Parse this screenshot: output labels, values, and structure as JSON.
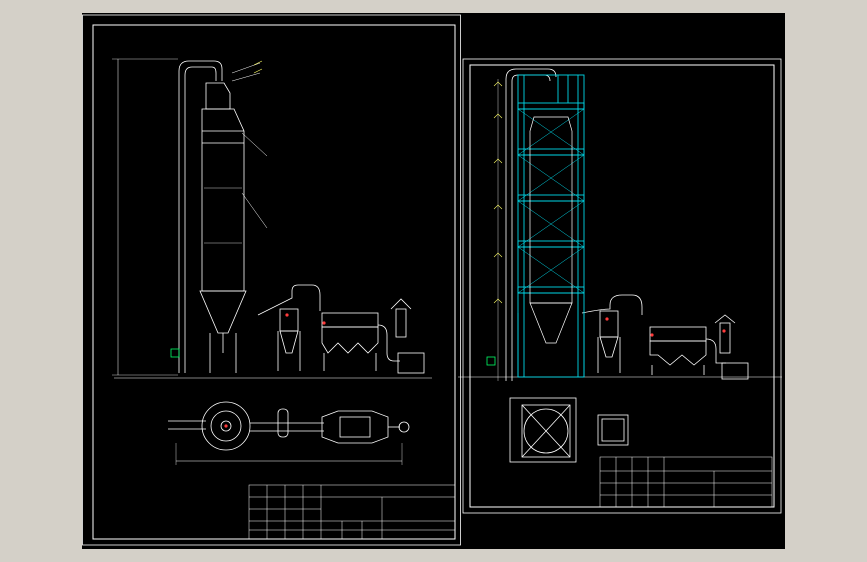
{
  "colors": {
    "background": "#d4d0c8",
    "canvas": "#000000",
    "line": "#ffffff",
    "structure": "#00d8e8",
    "annotation": "#ffff66",
    "accent": "#ff3b3b",
    "ground": "#00ff66"
  },
  "sheet1": {
    "title_block": {
      "rows": [
        "",
        "",
        "",
        "",
        "",
        "",
        ""
      ],
      "drawing_title": "",
      "drawing_no": "",
      "scale": ""
    }
  },
  "sheet2": {
    "title_block": {
      "drawing_title": "",
      "scale": ""
    }
  }
}
